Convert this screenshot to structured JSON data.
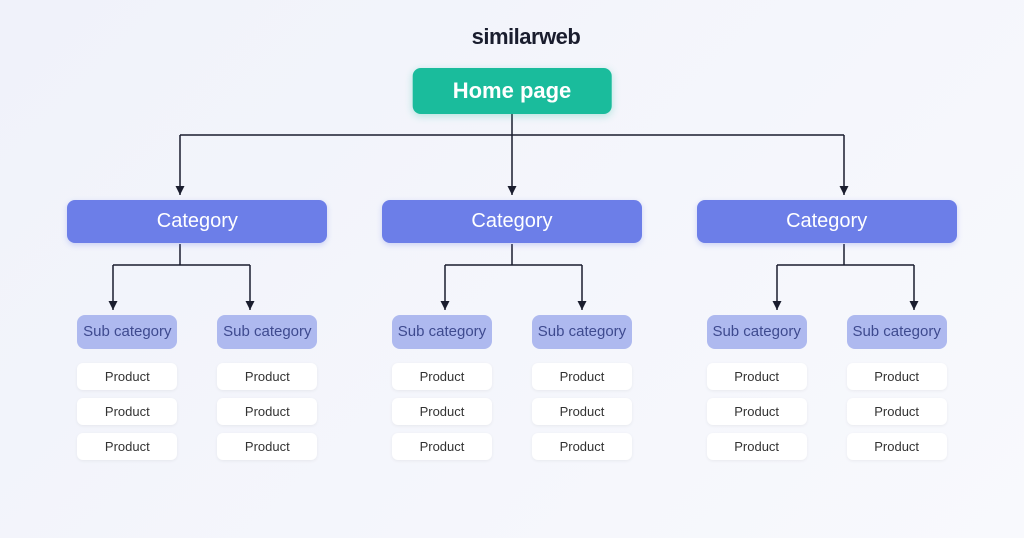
{
  "brand": {
    "name": "similarweb"
  },
  "root": {
    "label": "Home page"
  },
  "categories": [
    {
      "label": "Category",
      "subcategories": [
        {
          "label": "Sub category",
          "products": [
            "Product",
            "Product",
            "Product"
          ]
        },
        {
          "label": "Sub category",
          "products": [
            "Product",
            "Product",
            "Product"
          ]
        }
      ]
    },
    {
      "label": "Category",
      "subcategories": [
        {
          "label": "Sub category",
          "products": [
            "Product",
            "Product",
            "Product"
          ]
        },
        {
          "label": "Sub category",
          "products": [
            "Product",
            "Product",
            "Product"
          ]
        }
      ]
    },
    {
      "label": "Category",
      "subcategories": [
        {
          "label": "Sub category",
          "products": [
            "Product",
            "Product",
            "Product"
          ]
        },
        {
          "label": "Sub category",
          "products": [
            "Product",
            "Product",
            "Product"
          ]
        }
      ]
    }
  ],
  "colors": {
    "home": "#1abc9c",
    "category": "#6c7ee8",
    "subcategory": "#aeb9ef",
    "product_bg": "#ffffff",
    "brand_accent": "#f58220",
    "brand_dark": "#1a1d2e"
  }
}
